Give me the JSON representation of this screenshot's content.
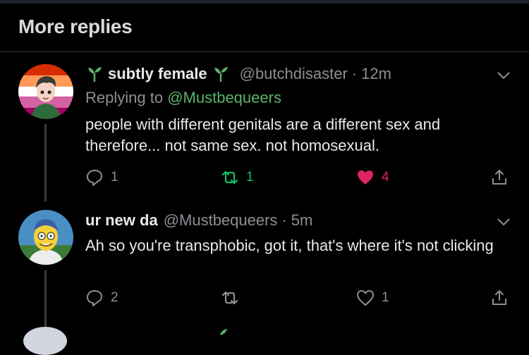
{
  "section": {
    "title": "More replies"
  },
  "tweets": [
    {
      "name": "subtly female",
      "handle": "@butchdisaster",
      "time": "12m",
      "replying_prefix": "Replying to",
      "replying_to": "@Mustbequeers",
      "text": "people with different genitals are a different sex and therefore... not same sex. not homosexual.",
      "replies": "1",
      "retweets": "1",
      "likes": "4",
      "liked": true,
      "avatar_icon": "lesbian-flag-avatar"
    },
    {
      "name": "ur new da",
      "handle": "@Mustbequeers",
      "time": "5m",
      "text": "Ah so you're transphobic, got it, that's where it's not clicking",
      "replies": "2",
      "retweets": "",
      "likes": "1",
      "liked": false,
      "avatar_icon": "cartoon-character-avatar"
    }
  ],
  "colors": {
    "accent_green": "#5ab26a",
    "retweet_green": "#17bf63",
    "like_red": "#e0245e",
    "muted": "#8b8f94"
  }
}
